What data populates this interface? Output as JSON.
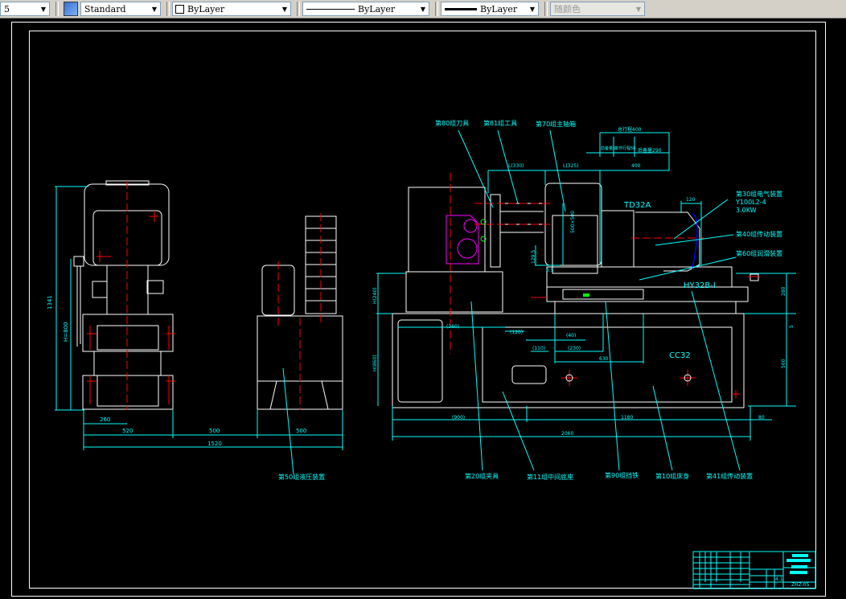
{
  "toolbar": {
    "layer_value": "5",
    "text_style": "Standard",
    "color": "ByLayer",
    "linetype": "ByLayer",
    "lineweight": "ByLayer",
    "plot_style": "随颜色"
  },
  "drawing": {
    "colors": {
      "background": "#000000",
      "outline": "#ffffff",
      "dimension": "#00ffff",
      "centerline": "#ff0000",
      "gearbox": "#ff00ff",
      "motor": "#0000ff",
      "green": "#00ff00"
    },
    "labels": {
      "tool": "第80组刀具",
      "tooling": "第81组工具",
      "headstock": "第70组主轴箱",
      "electrical": "第30组电气装置",
      "motor_model": "Y100L2-4",
      "motor_power": "3.0KW",
      "drive": "第40组传动装置",
      "lube": "第60组润滑装置",
      "fixture": "第20组夹具",
      "mid_base": "第11组中间底座",
      "stop": "第90组挡铁",
      "bed": "第10组床身",
      "drive2": "第41组传动装置",
      "hydraulic": "第50组液压装置",
      "td": "TD32A",
      "hy": "HY32B-I",
      "cc": "CC32"
    },
    "dims": {
      "total_stroke": "总行程400",
      "fwd": "前备量60",
      "work": "工作行程50",
      "back": "后备量290",
      "d330": "L(330)",
      "d325": "L(325)",
      "d400": "400",
      "d120": "120",
      "d500": "500×500",
      "d129": "129.5",
      "d05": "0.5",
      "d280": "280",
      "d240": "H(240)",
      "d360": "(360)",
      "d120b": "(120)",
      "d40": "(40)",
      "d110": "(110)",
      "d230": "(230)",
      "d630": "630",
      "d560": "560",
      "d5": "5",
      "d860": "H(860)",
      "d900": "(900)",
      "d1180": "1180",
      "d80": "80",
      "d2060": "2060",
      "d1341": "1341",
      "h800": "H=800",
      "d260": "260",
      "d520": "520",
      "d500b": "500",
      "d500c": "500",
      "d1520": "1520"
    },
    "title_block": {
      "code": "ZHZ-05",
      "scale": "4:1"
    }
  }
}
